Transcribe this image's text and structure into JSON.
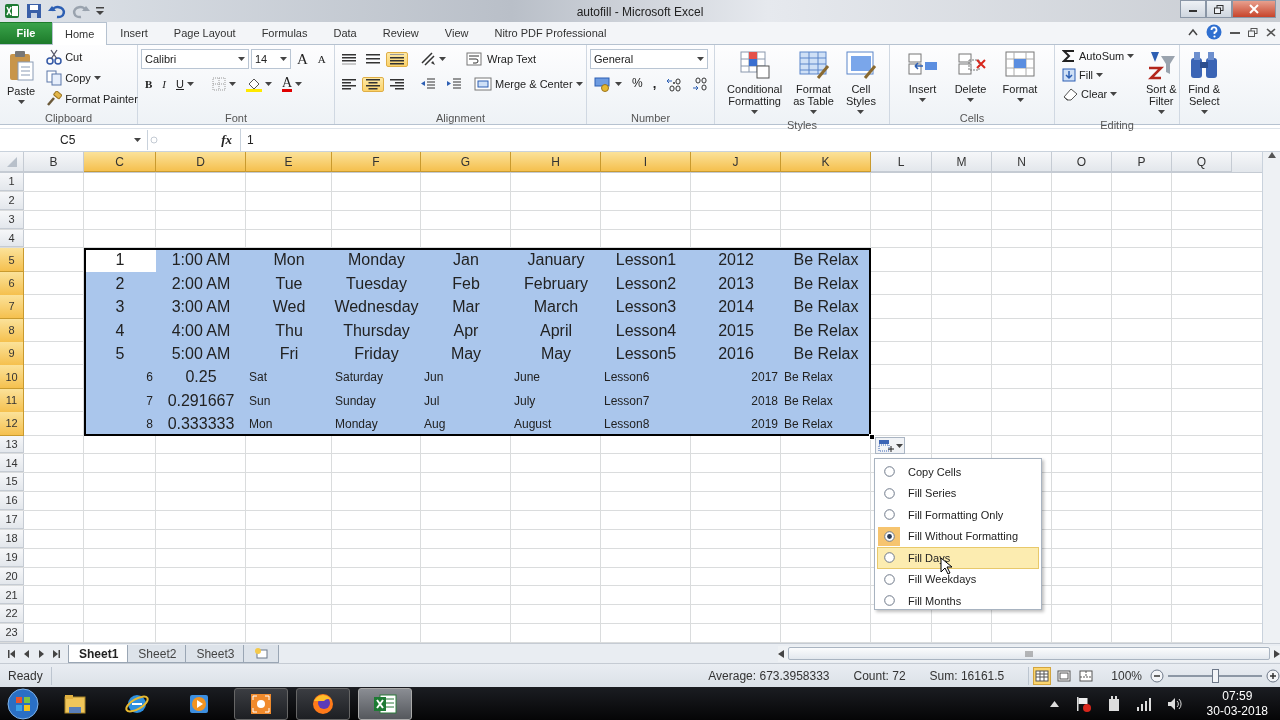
{
  "window": {
    "title": "autofill  -  Microsoft Excel"
  },
  "tabs": [
    {
      "label": "File",
      "kind": "file",
      "selected": false
    },
    {
      "label": "Home",
      "kind": "tab",
      "selected": true
    },
    {
      "label": "Insert",
      "kind": "tab",
      "selected": false
    },
    {
      "label": "Page Layout",
      "kind": "tab",
      "selected": false
    },
    {
      "label": "Formulas",
      "kind": "tab",
      "selected": false
    },
    {
      "label": "Data",
      "kind": "tab",
      "selected": false
    },
    {
      "label": "Review",
      "kind": "tab",
      "selected": false
    },
    {
      "label": "View",
      "kind": "tab",
      "selected": false
    },
    {
      "label": "Nitro PDF Professional",
      "kind": "tab",
      "selected": false
    }
  ],
  "ribbon": {
    "clipboard": {
      "label": "Clipboard",
      "paste": "Paste",
      "cut": "Cut",
      "copy": "Copy",
      "format_painter": "Format Painter"
    },
    "font": {
      "label": "Font",
      "family": "Calibri",
      "size": "14",
      "grow": "A",
      "shrink": "A",
      "bold": "B",
      "italic": "I",
      "underline": "U",
      "color_letter": "A"
    },
    "alignment": {
      "label": "Alignment",
      "vertical": [
        {
          "kind": "top",
          "selected": false
        },
        {
          "kind": "middle",
          "selected": false
        },
        {
          "kind": "bottom",
          "selected": true
        }
      ],
      "horizontal": [
        {
          "kind": "left",
          "selected": false
        },
        {
          "kind": "center",
          "selected": true
        },
        {
          "kind": "right",
          "selected": false
        }
      ],
      "wrap_text": "Wrap Text",
      "merge": "Merge & Center"
    },
    "number": {
      "label": "Number",
      "format": "General",
      "percent": "%",
      "comma": ","
    },
    "styles": {
      "label": "Styles",
      "buttons": [
        {
          "kind": "conditional",
          "lines": [
            "Conditional",
            "Formatting"
          ]
        },
        {
          "kind": "table",
          "lines": [
            "Format",
            "as Table"
          ]
        },
        {
          "kind": "cell",
          "lines": [
            "Cell",
            "Styles"
          ]
        }
      ]
    },
    "cells": {
      "label": "Cells",
      "buttons": [
        {
          "kind": "insert",
          "lines": [
            "Insert"
          ]
        },
        {
          "kind": "delete",
          "lines": [
            "Delete"
          ]
        },
        {
          "kind": "format",
          "lines": [
            "Format"
          ]
        }
      ]
    },
    "editing": {
      "label": "Editing",
      "autosum": "AutoSum",
      "fill": "Fill",
      "clear": "Clear",
      "buttons": [
        {
          "kind": "sort",
          "lines": [
            "Sort &",
            "Filter"
          ]
        },
        {
          "kind": "find",
          "lines": [
            "Find &",
            "Select"
          ]
        }
      ]
    }
  },
  "formula_bar": {
    "name_box": "C5",
    "fx": "fx",
    "value": "1"
  },
  "columns": [
    {
      "label": "B",
      "selected": false
    },
    {
      "label": "C",
      "selected": true
    },
    {
      "label": "D",
      "selected": true
    },
    {
      "label": "E",
      "selected": true
    },
    {
      "label": "F",
      "selected": true
    },
    {
      "label": "G",
      "selected": true
    },
    {
      "label": "H",
      "selected": true
    },
    {
      "label": "I",
      "selected": true
    },
    {
      "label": "J",
      "selected": true
    },
    {
      "label": "K",
      "selected": true
    },
    {
      "label": "L",
      "selected": false
    },
    {
      "label": "M",
      "selected": false
    },
    {
      "label": "N",
      "selected": false
    },
    {
      "label": "O",
      "selected": false
    },
    {
      "label": "P",
      "selected": false
    },
    {
      "label": "Q",
      "selected": false
    }
  ],
  "rows": [
    {
      "label": "1",
      "selected": false
    },
    {
      "label": "2",
      "selected": false
    },
    {
      "label": "3",
      "selected": false
    },
    {
      "label": "4",
      "selected": false
    },
    {
      "label": "5",
      "selected": true,
      "cells": [
        {
          "text": "1",
          "kind": "formatted",
          "selected": true,
          "active": true
        },
        {
          "text": "1:00 AM",
          "kind": "formatted",
          "selected": true,
          "active": false
        },
        {
          "text": "Mon",
          "kind": "formatted",
          "selected": true,
          "active": false
        },
        {
          "text": "Monday",
          "kind": "formatted",
          "selected": true,
          "active": false
        },
        {
          "text": "Jan",
          "kind": "formatted",
          "selected": true,
          "active": false
        },
        {
          "text": "January",
          "kind": "formatted",
          "selected": true,
          "active": false
        },
        {
          "text": "Lesson1",
          "kind": "formatted",
          "selected": true,
          "active": false
        },
        {
          "text": "2012",
          "kind": "formatted",
          "selected": true,
          "active": false
        },
        {
          "text": "Be Relax",
          "kind": "formatted",
          "selected": true,
          "active": false
        }
      ]
    },
    {
      "label": "6",
      "selected": true,
      "cells": [
        {
          "text": "2",
          "kind": "formatted",
          "selected": true,
          "active": false
        },
        {
          "text": "2:00 AM",
          "kind": "formatted",
          "selected": true,
          "active": false
        },
        {
          "text": "Tue",
          "kind": "formatted",
          "selected": true,
          "active": false
        },
        {
          "text": "Tuesday",
          "kind": "formatted",
          "selected": true,
          "active": false
        },
        {
          "text": "Feb",
          "kind": "formatted",
          "selected": true,
          "active": false
        },
        {
          "text": "February",
          "kind": "formatted",
          "selected": true,
          "active": false
        },
        {
          "text": "Lesson2",
          "kind": "formatted",
          "selected": true,
          "active": false
        },
        {
          "text": "2013",
          "kind": "formatted",
          "selected": true,
          "active": false
        },
        {
          "text": "Be Relax",
          "kind": "formatted",
          "selected": true,
          "active": false
        }
      ]
    },
    {
      "label": "7",
      "selected": true,
      "cells": [
        {
          "text": "3",
          "kind": "formatted",
          "selected": true,
          "active": false
        },
        {
          "text": "3:00 AM",
          "kind": "formatted",
          "selected": true,
          "active": false
        },
        {
          "text": "Wed",
          "kind": "formatted",
          "selected": true,
          "active": false
        },
        {
          "text": "Wednesday",
          "kind": "formatted",
          "selected": true,
          "active": false
        },
        {
          "text": "Mar",
          "kind": "formatted",
          "selected": true,
          "active": false
        },
        {
          "text": "March",
          "kind": "formatted",
          "selected": true,
          "active": false
        },
        {
          "text": "Lesson3",
          "kind": "formatted",
          "selected": true,
          "active": false
        },
        {
          "text": "2014",
          "kind": "formatted",
          "selected": true,
          "active": false
        },
        {
          "text": "Be Relax",
          "kind": "formatted",
          "selected": true,
          "active": false
        }
      ]
    },
    {
      "label": "8",
      "selected": true,
      "cells": [
        {
          "text": "4",
          "kind": "formatted",
          "selected": true,
          "active": false
        },
        {
          "text": "4:00 AM",
          "kind": "formatted",
          "selected": true,
          "active": false
        },
        {
          "text": "Thu",
          "kind": "formatted",
          "selected": true,
          "active": false
        },
        {
          "text": "Thursday",
          "kind": "formatted",
          "selected": true,
          "active": false
        },
        {
          "text": "Apr",
          "kind": "formatted",
          "selected": true,
          "active": false
        },
        {
          "text": "April",
          "kind": "formatted",
          "selected": true,
          "active": false
        },
        {
          "text": "Lesson4",
          "kind": "formatted",
          "selected": true,
          "active": false
        },
        {
          "text": "2015",
          "kind": "formatted",
          "selected": true,
          "active": false
        },
        {
          "text": "Be Relax",
          "kind": "formatted",
          "selected": true,
          "active": false
        }
      ]
    },
    {
      "label": "9",
      "selected": true,
      "cells": [
        {
          "text": "5",
          "kind": "formatted",
          "selected": true,
          "active": false
        },
        {
          "text": "5:00 AM",
          "kind": "formatted",
          "selected": true,
          "active": false
        },
        {
          "text": "Fri",
          "kind": "formatted",
          "selected": true,
          "active": false
        },
        {
          "text": "Friday",
          "kind": "formatted",
          "selected": true,
          "active": false
        },
        {
          "text": "May",
          "kind": "formatted",
          "selected": true,
          "active": false
        },
        {
          "text": "May",
          "kind": "formatted",
          "selected": true,
          "active": false
        },
        {
          "text": "Lesson5",
          "kind": "formatted",
          "selected": true,
          "active": false
        },
        {
          "text": "2016",
          "kind": "formatted",
          "selected": true,
          "active": false
        },
        {
          "text": "Be Relax",
          "kind": "formatted",
          "selected": true,
          "active": false
        }
      ]
    },
    {
      "label": "10",
      "selected": true,
      "cells": [
        {
          "text": "6",
          "kind": "number",
          "selected": true,
          "active": false
        },
        {
          "text": "0.25",
          "kind": "formatted",
          "selected": true,
          "active": false
        },
        {
          "text": "Sat",
          "kind": "text",
          "selected": true,
          "active": false
        },
        {
          "text": "Saturday",
          "kind": "text",
          "selected": true,
          "active": false
        },
        {
          "text": "Jun",
          "kind": "text",
          "selected": true,
          "active": false
        },
        {
          "text": "June",
          "kind": "text",
          "selected": true,
          "active": false
        },
        {
          "text": "Lesson6",
          "kind": "text",
          "selected": true,
          "active": false
        },
        {
          "text": "2017",
          "kind": "number",
          "selected": true,
          "active": false
        },
        {
          "text": "Be Relax",
          "kind": "text",
          "selected": true,
          "active": false
        }
      ]
    },
    {
      "label": "11",
      "selected": true,
      "cells": [
        {
          "text": "7",
          "kind": "number",
          "selected": true,
          "active": false
        },
        {
          "text": "0.291667",
          "kind": "formatted",
          "selected": true,
          "active": false
        },
        {
          "text": "Sun",
          "kind": "text",
          "selected": true,
          "active": false
        },
        {
          "text": "Sunday",
          "kind": "text",
          "selected": true,
          "active": false
        },
        {
          "text": "Jul",
          "kind": "text",
          "selected": true,
          "active": false
        },
        {
          "text": "July",
          "kind": "text",
          "selected": true,
          "active": false
        },
        {
          "text": "Lesson7",
          "kind": "text",
          "selected": true,
          "active": false
        },
        {
          "text": "2018",
          "kind": "number",
          "selected": true,
          "active": false
        },
        {
          "text": "Be Relax",
          "kind": "text",
          "selected": true,
          "active": false
        }
      ]
    },
    {
      "label": "12",
      "selected": true,
      "cells": [
        {
          "text": "8",
          "kind": "number",
          "selected": true,
          "active": false
        },
        {
          "text": "0.333333",
          "kind": "formatted",
          "selected": true,
          "active": false
        },
        {
          "text": "Mon",
          "kind": "text",
          "selected": true,
          "active": false
        },
        {
          "text": "Monday",
          "kind": "text",
          "selected": true,
          "active": false
        },
        {
          "text": "Aug",
          "kind": "text",
          "selected": true,
          "active": false
        },
        {
          "text": "August",
          "kind": "text",
          "selected": true,
          "active": false
        },
        {
          "text": "Lesson8",
          "kind": "text",
          "selected": true,
          "active": false
        },
        {
          "text": "2019",
          "kind": "number",
          "selected": true,
          "active": false
        },
        {
          "text": "Be Relax",
          "kind": "text",
          "selected": true,
          "active": false
        }
      ]
    },
    {
      "label": "13",
      "selected": false
    },
    {
      "label": "14",
      "selected": false
    },
    {
      "label": "15",
      "selected": false
    },
    {
      "label": "16",
      "selected": false
    },
    {
      "label": "17",
      "selected": false
    },
    {
      "label": "18",
      "selected": false
    },
    {
      "label": "19",
      "selected": false
    },
    {
      "label": "20",
      "selected": false
    },
    {
      "label": "21",
      "selected": false
    },
    {
      "label": "22",
      "selected": false
    },
    {
      "label": "23",
      "selected": false
    }
  ],
  "autofill_menu": {
    "items": [
      {
        "label": "Copy Cells",
        "selected": false,
        "highlighted": false
      },
      {
        "label": "Fill Series",
        "selected": false,
        "highlighted": false
      },
      {
        "label": "Fill Formatting Only",
        "selected": false,
        "highlighted": false
      },
      {
        "label": "Fill Without Formatting",
        "selected": true,
        "highlighted": false
      },
      {
        "label": "Fill Days",
        "selected": false,
        "highlighted": true
      },
      {
        "label": "Fill Weekdays",
        "selected": false,
        "highlighted": false
      },
      {
        "label": "Fill Months",
        "selected": false,
        "highlighted": false
      }
    ]
  },
  "sheet_tabs": [
    {
      "label": "Sheet1",
      "selected": true
    },
    {
      "label": "Sheet2",
      "selected": false
    },
    {
      "label": "Sheet3",
      "selected": false
    }
  ],
  "status_bar": {
    "mode": "Ready",
    "average": "Average: 673.3958333",
    "count": "Count: 72",
    "sum": "Sum: 16161.5",
    "views": [
      {
        "kind": "normal",
        "selected": true
      },
      {
        "kind": "layout",
        "selected": false
      },
      {
        "kind": "break",
        "selected": false
      }
    ],
    "zoom": "100%",
    "zoom_slider": {
      "level": 0.5
    }
  },
  "taskbar": {
    "apps": [
      {
        "kind": "explorer",
        "running": false,
        "active": false
      },
      {
        "kind": "browser",
        "running": false,
        "active": false
      },
      {
        "kind": "media",
        "running": false,
        "active": false
      },
      {
        "kind": "recorder",
        "running": true,
        "active": false
      },
      {
        "kind": "firefox",
        "running": true,
        "active": false
      },
      {
        "kind": "excel",
        "running": true,
        "active": true
      }
    ],
    "time": "07:59",
    "date": "30-03-2018"
  }
}
